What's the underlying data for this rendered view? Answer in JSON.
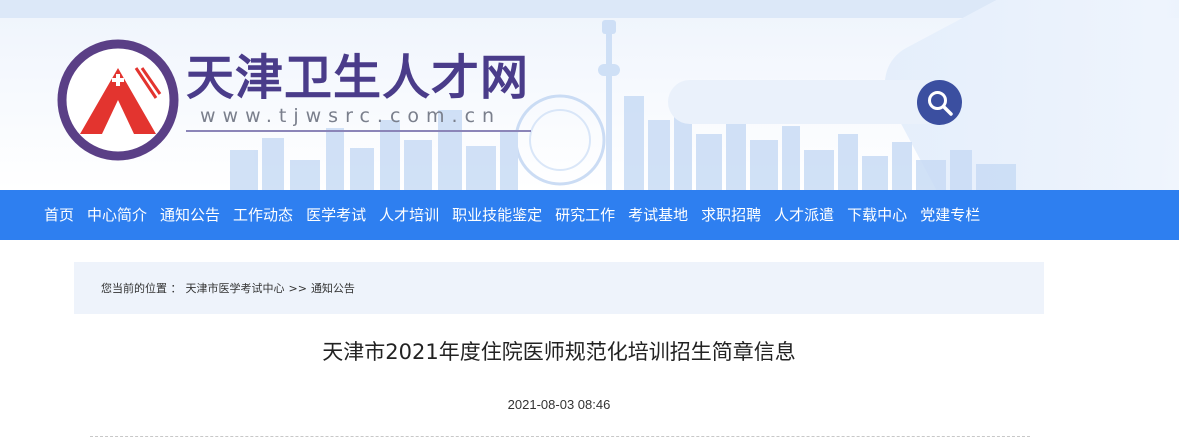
{
  "header": {
    "site_name": "天津卫生人才网",
    "site_url": "www.tjwsrc.com.cn",
    "search": {
      "placeholder": ""
    }
  },
  "nav": {
    "items": [
      {
        "label": "首页"
      },
      {
        "label": "中心简介"
      },
      {
        "label": "通知公告"
      },
      {
        "label": "工作动态"
      },
      {
        "label": "医学考试"
      },
      {
        "label": "人才培训"
      },
      {
        "label": "职业技能鉴定"
      },
      {
        "label": "研究工作"
      },
      {
        "label": "考试基地"
      },
      {
        "label": "求职招聘"
      },
      {
        "label": "人才派遣"
      },
      {
        "label": "下载中心"
      },
      {
        "label": "党建专栏"
      }
    ]
  },
  "breadcrumb": {
    "prefix": "您当前的位置 ：",
    "level1": "天津市医学考试中心",
    "separator": ">>",
    "level2": "通知公告"
  },
  "article": {
    "title": "天津市2021年度住院医师规范化培训招生简章信息",
    "date": "2021-08-03 08:46"
  },
  "colors": {
    "nav_bg": "#2e7ff0",
    "brand_purple": "#4a3c8a",
    "logo_red": "#e3342f",
    "search_button": "#3b4fa0"
  }
}
